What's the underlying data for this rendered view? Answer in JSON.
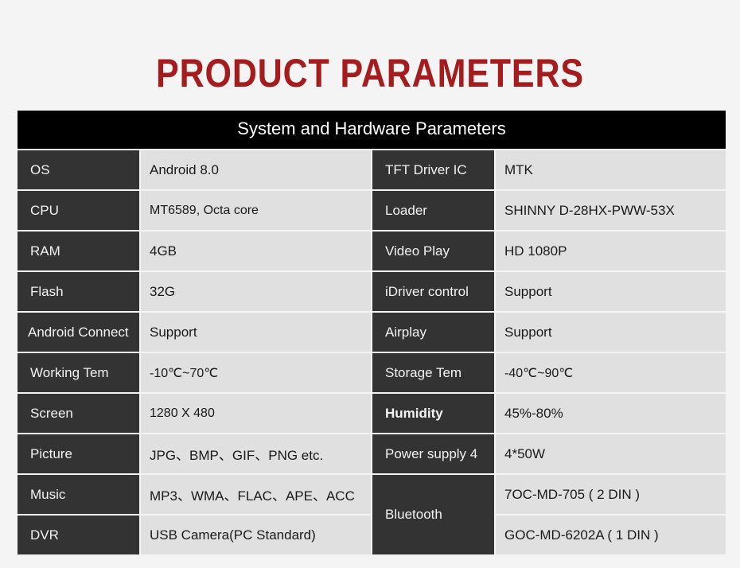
{
  "page_title": "PRODUCT PARAMETERS",
  "table": {
    "header": "System and Hardware Parameters",
    "left": [
      {
        "label": "OS",
        "value": "Android 8.0"
      },
      {
        "label": "CPU",
        "value": "MT6589, Octa core"
      },
      {
        "label": "RAM",
        "value": "4GB"
      },
      {
        "label": "Flash",
        "value": "32G"
      },
      {
        "label": "Android Connect",
        "value": "Support"
      },
      {
        "label": "Working Tem",
        "value": "-10℃~70℃"
      },
      {
        "label": "Screen",
        "value": "1280 X 480"
      },
      {
        "label": "Picture",
        "value": "JPG、BMP、GIF、PNG etc."
      },
      {
        "label": "Music",
        "value": "MP3、WMA、FLAC、APE、ACC"
      },
      {
        "label": "DVR",
        "value": "USB Camera(PC Standard)"
      }
    ],
    "right": [
      {
        "label": "TFT Driver IC",
        "value": "MTK"
      },
      {
        "label": "Loader",
        "value": "SHINNY D-28HX-PWW-53X"
      },
      {
        "label": "Video Play",
        "value": "HD 1080P"
      },
      {
        "label": "iDriver control",
        "value": "Support"
      },
      {
        "label": "Airplay",
        "value": "Support"
      },
      {
        "label": "Storage Tem",
        "value": "-40℃~90℃"
      },
      {
        "label": "Humidity",
        "value": "45%-80%"
      },
      {
        "label": "Power supply 4",
        "value": "4*50W"
      }
    ],
    "bluetooth": {
      "label": "Bluetooth",
      "values": [
        "7OC-MD-705 ( 2 DIN )",
        "GOC-MD-6202A ( 1 DIN )"
      ]
    }
  }
}
